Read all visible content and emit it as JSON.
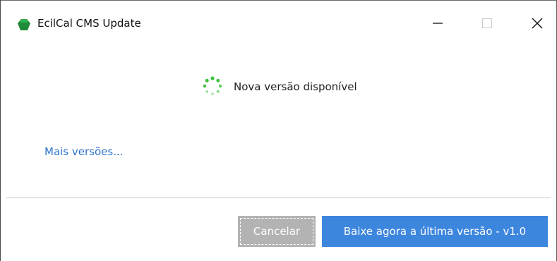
{
  "window": {
    "title": "EcilCal CMS Update",
    "icon": "green-gem-icon",
    "controls": {
      "minimize_icon": "minimize-icon",
      "maximize_icon": "maximize-icon",
      "close_icon": "close-icon"
    }
  },
  "main": {
    "status_text": "Nova versão disponível",
    "spinner_icon": "loading-spinner-icon",
    "more_versions_link": "Mais versões..."
  },
  "footer": {
    "cancel_label": "Cancelar",
    "download_label": "Baixe agora a última versão - v1.0"
  },
  "colors": {
    "primary_button": "#3d86de",
    "disabled_button": "#b3b3b3",
    "link": "#2f73c9",
    "spinner": "#3cc13c",
    "app_icon": "#1f8a3a"
  }
}
